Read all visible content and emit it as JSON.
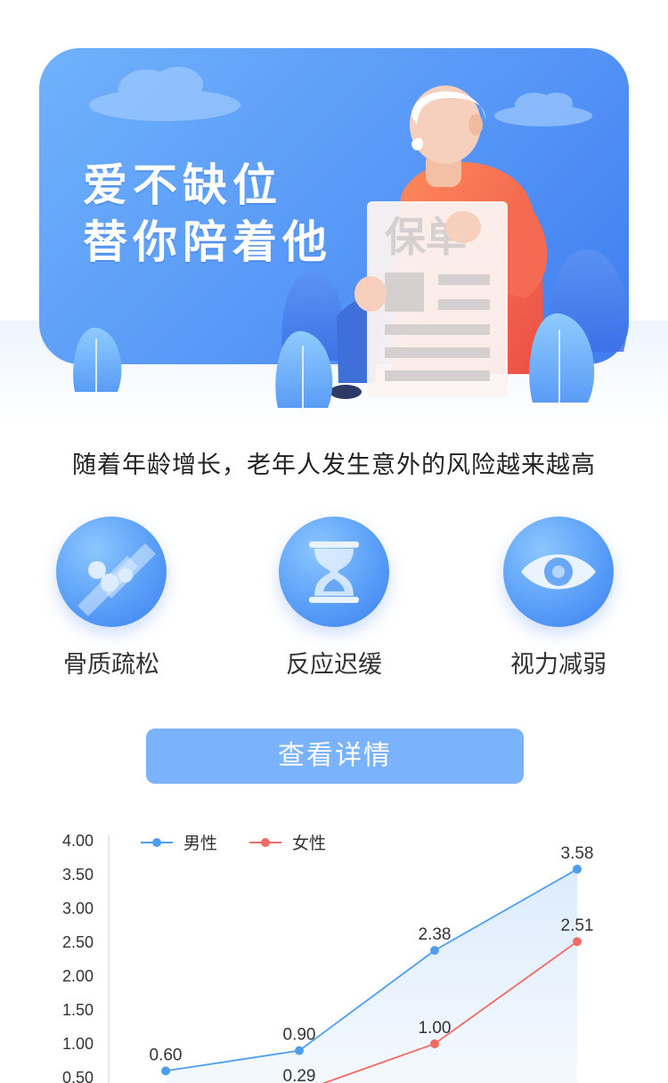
{
  "hero": {
    "slogan_line1": "爱不缺位",
    "slogan_line2": "替你陪着他",
    "sign_text": "保单",
    "colors": {
      "card_start": "#6fb2fb",
      "card_end": "#3f7cf0",
      "shirt": "#f2684e"
    }
  },
  "subtitle": "随着年龄增长，老年人发生意外的风险越来越高",
  "features": [
    {
      "label": "骨质疏松",
      "icon": "bone-icon"
    },
    {
      "label": "反应迟缓",
      "icon": "hourglass-icon"
    },
    {
      "label": "视力减弱",
      "icon": "eye-icon"
    }
  ],
  "button": {
    "label": "查看详情",
    "color": "#7ab3fb"
  },
  "chart_data": {
    "type": "line",
    "title": "",
    "xlabel": "",
    "ylabel": "",
    "ylim": [
      0.0,
      4.0
    ],
    "yticks": [
      "4.00",
      "3.50",
      "3.00",
      "2.50",
      "2.00",
      "1.50",
      "1.00",
      "0.50"
    ],
    "grid": false,
    "legend_position": "top-left",
    "series": [
      {
        "name": "男性",
        "color": "#4e9ef0",
        "values": [
          0.6,
          0.9,
          2.38,
          3.58
        ],
        "labels": [
          "0.60",
          "0.90",
          "2.38",
          "3.58"
        ]
      },
      {
        "name": "女性",
        "color": "#ef6b63",
        "values": [
          null,
          0.29,
          1.0,
          2.51
        ],
        "labels": [
          "",
          "0.29",
          "1.00",
          "2.51"
        ]
      }
    ]
  }
}
